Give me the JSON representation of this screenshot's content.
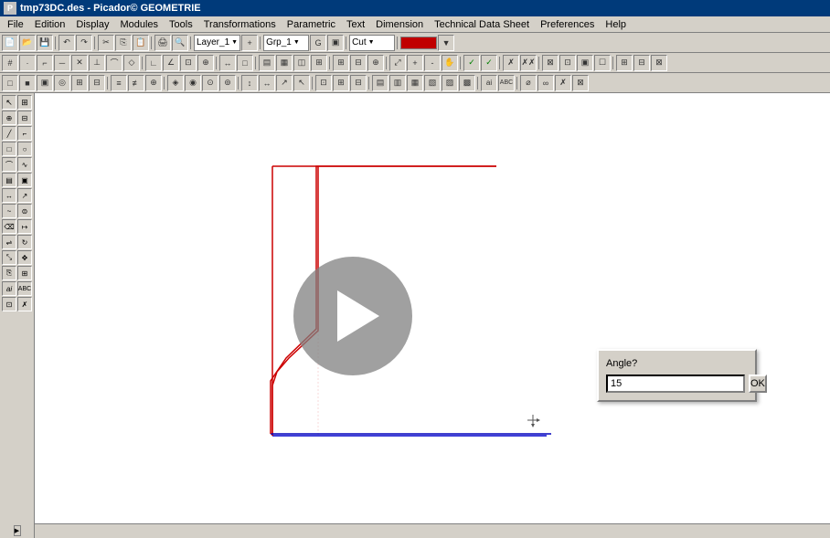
{
  "titleBar": {
    "icon": "P",
    "title": "tmp73DC.des - Picador© GEOMETRIE"
  },
  "menuBar": {
    "items": [
      {
        "label": "File",
        "id": "menu-file"
      },
      {
        "label": "Edition",
        "id": "menu-edition"
      },
      {
        "label": "Display",
        "id": "menu-display"
      },
      {
        "label": "Modules",
        "id": "menu-modules"
      },
      {
        "label": "Tools",
        "id": "menu-tools"
      },
      {
        "label": "Transformations",
        "id": "menu-transformations"
      },
      {
        "label": "Parametric",
        "id": "menu-parametric"
      },
      {
        "label": "Text",
        "id": "menu-text"
      },
      {
        "label": "Dimension",
        "id": "menu-dimension"
      },
      {
        "label": "Technical Data Sheet",
        "id": "menu-tds"
      },
      {
        "label": "Preferences",
        "id": "menu-preferences"
      },
      {
        "label": "Help",
        "id": "menu-help"
      }
    ]
  },
  "toolbar1": {
    "dropdowns": [
      {
        "label": "Layer_1",
        "id": "dd-layer"
      },
      {
        "label": "Grp_1",
        "id": "dd-grp"
      },
      {
        "label": "Cut",
        "id": "dd-cut"
      }
    ]
  },
  "dialog": {
    "label": "Angle?",
    "inputValue": "15",
    "okLabel": "OK"
  },
  "canvas": {
    "bgColor": "#ffffff"
  },
  "statusBar": {
    "text": ""
  }
}
